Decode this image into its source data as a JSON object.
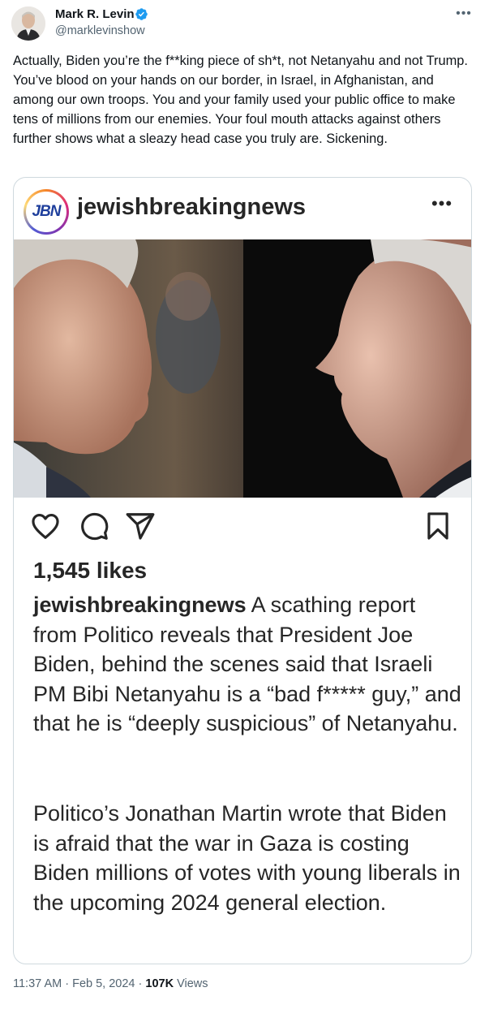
{
  "author": {
    "name": "Mark R. Levin",
    "handle": "@marklevinshow",
    "verified_color": "#1d9bf0"
  },
  "tweet": {
    "text": "Actually, Biden you’re the f**king piece of sh*t, not Netanyahu and not Trump. You’ve blood on your hands on our border, in Israel, in Afghanistan, and among our own troops. You and your family used your public office to make tens of millions from our enemies. Your foul mouth attacks against others further shows what a sleazy head case you truly are. Sickening."
  },
  "embedded_post": {
    "logo_text": "JBN",
    "account": "jewishbreakingnews",
    "likes": "1,545 likes",
    "caption_user": "jewishbreakingnews",
    "caption_text": " A scathing report from Politico reveals that President Joe Biden, behind the scenes said that Israeli PM  Bibi Netanyahu is a “bad f***** guy,” and that he is “deeply suspicious” of Netanyahu.",
    "caption_text_2": "Politico’s Jonathan Martin wrote that Biden is afraid that the war in Gaza is costing Biden millions of votes with young liberals in the upcoming 2024 general election.",
    "icons": [
      "heart-icon",
      "comment-icon",
      "share-icon",
      "bookmark-icon"
    ]
  },
  "meta": {
    "time": "11:37 AM",
    "separator": " · ",
    "date": "Feb 5, 2024",
    "views_count": "107K",
    "views_label": " Views"
  }
}
